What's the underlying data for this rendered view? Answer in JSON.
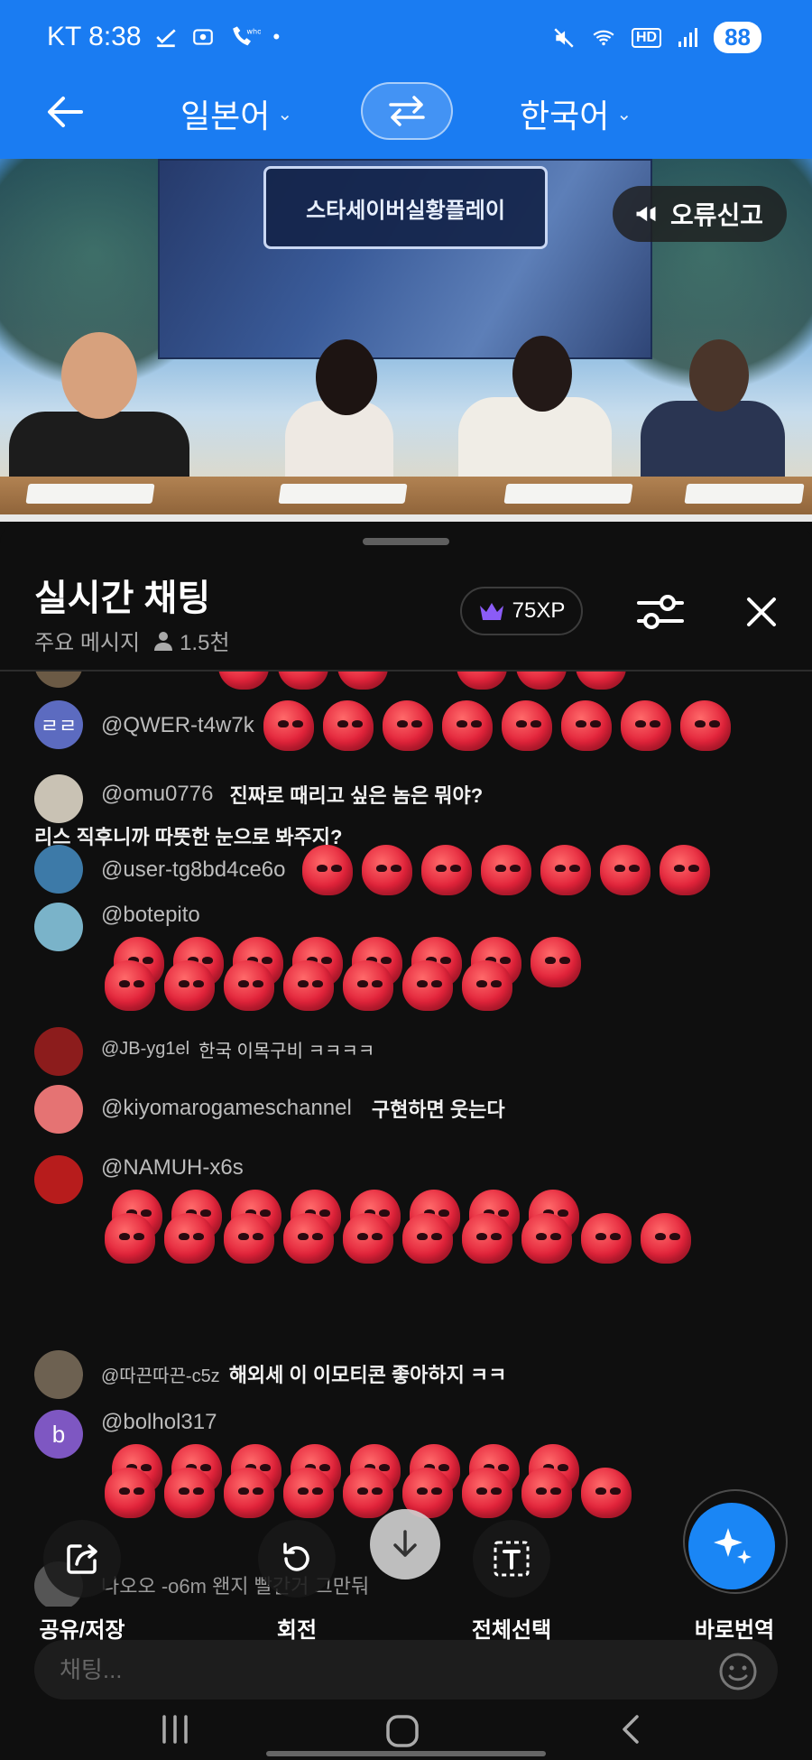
{
  "status_bar": {
    "carrier_time": "KT 8:38",
    "battery": "88"
  },
  "translator": {
    "source_lang": "일본어",
    "target_lang": "한국어"
  },
  "video": {
    "stage_sign": "스타세이버실황플레이",
    "report_label": "오류신고"
  },
  "chat": {
    "title": "실시간 채팅",
    "mode": "주요 메시지",
    "viewers": "1.5천",
    "xp": "75XP",
    "messages": [
      {
        "avatar_text": "ㄹㄹ",
        "author": "@QWER-t4w7k",
        "text": "",
        "emoji_count": 8
      },
      {
        "avatar_text": "",
        "author": "@omu0776",
        "text": "진짜로 때리고 싶은 놈은 뭐야?",
        "text2": "리스 직후니까 따뜻한 눈으로 봐주지?",
        "emoji_count": 0
      },
      {
        "avatar_text": "",
        "author": "@user-tg8bd4ce6o",
        "text": "",
        "emoji_count": 7
      },
      {
        "avatar_text": "",
        "author": "@botepito",
        "text": "",
        "emoji_count": 15
      },
      {
        "avatar_text": "",
        "author": "@JB-yg1el",
        "text": "한국 이목구비 ㅋㅋㅋㅋ",
        "emoji_count": 0
      },
      {
        "avatar_text": "",
        "author": "@kiyomarogameschannel",
        "text": "구현하면 웃는다",
        "emoji_count": 0
      },
      {
        "avatar_text": "",
        "author": "@NAMUH-x6s",
        "text": "",
        "emoji_count": 18
      },
      {
        "avatar_text": "",
        "author": "@따끈따끈-c5z",
        "text": "해외세 이 이모티콘 좋아하지 ㅋㅋ",
        "emoji_count": 0
      },
      {
        "avatar_text": "b",
        "author": "@bolhol317",
        "text": "",
        "emoji_count": 17
      },
      {
        "avatar_text": "",
        "author": "",
        "text": "나오오 -o6m 왠지 빨간거 그만둬",
        "emoji_count": 0
      }
    ]
  },
  "actions": {
    "share_label": "공유/저장",
    "rotate_label": "회전",
    "select_all_label": "전체선택",
    "translate_label": "바로번역"
  },
  "input": {
    "placeholder": "채팅..."
  },
  "colors": {
    "accent": "#1a7cf2",
    "fab": "#1a86f5",
    "background": "#0f0f0f"
  }
}
